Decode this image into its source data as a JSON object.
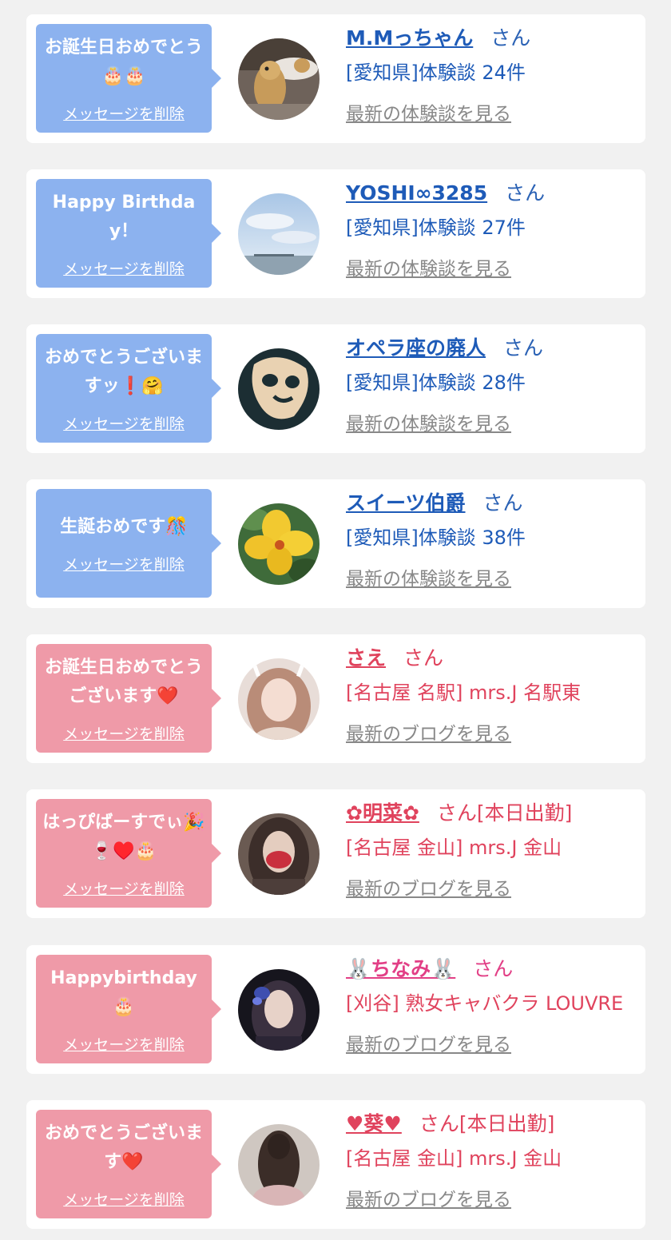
{
  "cards": [
    {
      "message": "お誕生日おめでとう🎂🎂",
      "delete_label": "メッセージを削除",
      "name": "M.Mっちゃん",
      "suffix": "さん",
      "description": "[愛知県]体験談 24件",
      "latest_label": "最新の体験談を見る",
      "theme": "blue"
    },
    {
      "message": "Happy Birthday！",
      "delete_label": "メッセージを削除",
      "name": "YOSHI∞3285",
      "suffix": "さん",
      "description": "[愛知県]体験談 27件",
      "latest_label": "最新の体験談を見る",
      "theme": "blue"
    },
    {
      "message": "おめでとうございますッ❗🤗",
      "delete_label": "メッセージを削除",
      "name": "オペラ座の廃人",
      "suffix": "さん",
      "description": "[愛知県]体験談 28件",
      "latest_label": "最新の体験談を見る",
      "theme": "blue"
    },
    {
      "message": "生誕おめです🎊",
      "delete_label": "メッセージを削除",
      "name": "スイーツ伯爵",
      "suffix": "さん",
      "description": "[愛知県]体験談 38件",
      "latest_label": "最新の体験談を見る",
      "theme": "blue"
    },
    {
      "message": "お誕生日おめでとうございます❤️",
      "delete_label": "メッセージを削除",
      "name": "さえ",
      "suffix": "さん",
      "description": "[名古屋 名駅] mrs.J 名駅東",
      "latest_label": "最新のブログを見る",
      "theme": "pink"
    },
    {
      "message": "はっぴばーすでぃ🎉🍷♥️🎂",
      "delete_label": "メッセージを削除",
      "name": "✿明菜✿",
      "suffix": "さん[本日出勤]",
      "description": "[名古屋 金山] mrs.J 金山",
      "latest_label": "最新のブログを見る",
      "theme": "pink"
    },
    {
      "message": "Happybirthday🎂",
      "delete_label": "メッセージを削除",
      "name": "🐰ちなみ🐰",
      "suffix": "さん",
      "description": "[刈谷] 熟女キャバクラ LOUVRE",
      "latest_label": "最新のブログを見る",
      "theme": "pink"
    },
    {
      "message": "おめでとうございます❤️",
      "delete_label": "メッセージを削除",
      "name": "♥葵♥",
      "suffix": "さん[本日出勤]",
      "description": "[名古屋 金山] mrs.J 金山",
      "latest_label": "最新のブログを見る",
      "theme": "pink"
    }
  ]
}
